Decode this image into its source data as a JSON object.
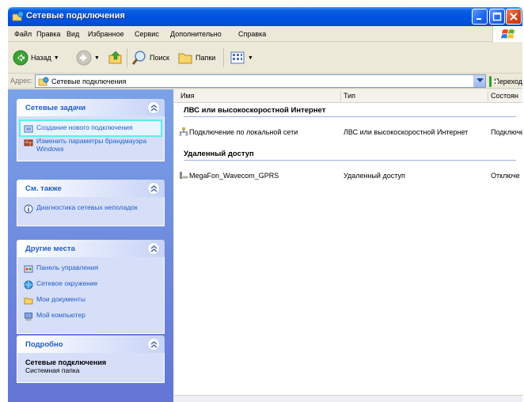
{
  "window": {
    "title": "Сетевые подключения",
    "icon": "network-folder-icon"
  },
  "menu": [
    "Файл",
    "Правка",
    "Вид",
    "Избранное",
    "Сервис",
    "Дополнительно",
    "Справка"
  ],
  "toolbar": {
    "back_label": "Назад",
    "search_label": "Поиск",
    "folders_label": "Папки"
  },
  "address": {
    "label": "Адрес:",
    "value": "Сетевые подключения",
    "go_label": "Переход"
  },
  "tasks_panel": {
    "title": "Сетевые задачи",
    "items": [
      {
        "label": "Создание нового подключения",
        "icon": "new-connection-icon"
      },
      {
        "label": "Изменить параметры брандмауэра Windows",
        "icon": "firewall-icon"
      }
    ]
  },
  "see_also_panel": {
    "title": "См. также",
    "items": [
      {
        "label": "Диагностика сетевых неполадок",
        "icon": "info-icon"
      }
    ]
  },
  "other_places_panel": {
    "title": "Другие места",
    "items": [
      {
        "label": "Панель управления",
        "icon": "control-panel-icon"
      },
      {
        "label": "Сетевое окружение",
        "icon": "network-places-icon"
      },
      {
        "label": "Мои документы",
        "icon": "my-documents-icon"
      },
      {
        "label": "Мой компьютер",
        "icon": "my-computer-icon"
      }
    ]
  },
  "details_panel": {
    "title": "Подробно",
    "name": "Сетевые подключения",
    "type": "Системная папка"
  },
  "list": {
    "columns": [
      "Имя",
      "Тип",
      "Состоян"
    ],
    "groups": [
      {
        "title": "ЛВС или высокоскоростной Интернет",
        "rows": [
          {
            "name": "Подключение по локальной сети",
            "type": "ЛВС или высокоскоростной Интернет",
            "status": "Подключе"
          }
        ]
      },
      {
        "title": "Удаленный доступ",
        "rows": [
          {
            "name": "MegaFon_Wavecom_GPRS",
            "type": "Удаленный доступ",
            "status": "Отключе"
          }
        ]
      }
    ]
  },
  "colors": {
    "title_bar": "#0054e3",
    "task_pane": "#7ba2e7",
    "panel_body": "#d6dff7",
    "panel_title": "#215dc6",
    "selection_outline": "#5af0e9"
  }
}
